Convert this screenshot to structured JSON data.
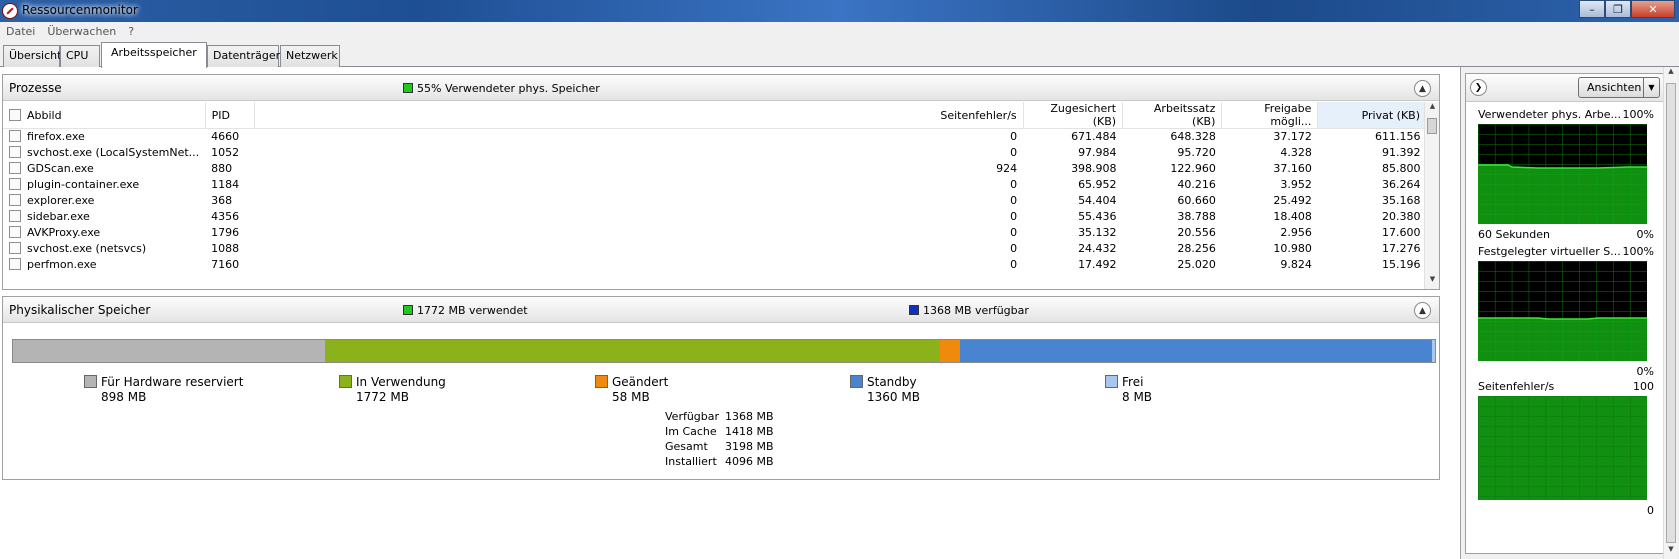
{
  "window": {
    "title": "Ressourcenmonitor"
  },
  "menu": [
    "Datei",
    "Überwachen",
    "?"
  ],
  "tabs": [
    "Übersicht",
    "CPU",
    "Arbeitsspeicher",
    "Datenträger",
    "Netzwerk"
  ],
  "active_tab": "Arbeitsspeicher",
  "processes": {
    "title": "Prozesse",
    "legend_text": "55% Verwendeter phys. Speicher",
    "legend_color": "#1fc81f",
    "columns": [
      "Abbild",
      "PID",
      "Seitenfehler/s",
      "Zugesichert (KB)",
      "Arbeitssatz (KB)",
      "Freigabe mögli...",
      "Privat (KB)"
    ],
    "rows": [
      [
        "firefox.exe",
        "4660",
        "0",
        "671.484",
        "648.328",
        "37.172",
        "611.156"
      ],
      [
        "svchost.exe (LocalSystemNet...",
        "1052",
        "0",
        "97.984",
        "95.720",
        "4.328",
        "91.392"
      ],
      [
        "GDScan.exe",
        "880",
        "924",
        "398.908",
        "122.960",
        "37.160",
        "85.800"
      ],
      [
        "plugin-container.exe",
        "1184",
        "0",
        "65.952",
        "40.216",
        "3.952",
        "36.264"
      ],
      [
        "explorer.exe",
        "368",
        "0",
        "54.404",
        "60.660",
        "25.492",
        "35.168"
      ],
      [
        "sidebar.exe",
        "4356",
        "0",
        "55.436",
        "38.788",
        "18.408",
        "20.380"
      ],
      [
        "AVKProxy.exe",
        "1796",
        "0",
        "35.132",
        "20.556",
        "2.956",
        "17.600"
      ],
      [
        "svchost.exe (netsvcs)",
        "1088",
        "0",
        "24.432",
        "28.256",
        "10.980",
        "17.276"
      ],
      [
        "perfmon.exe",
        "7160",
        "0",
        "17.492",
        "25.020",
        "9.824",
        "15.196"
      ]
    ]
  },
  "physical": {
    "title": "Physikalischer Speicher",
    "used_label": "1772 MB verwendet",
    "used_color": "#1fc81f",
    "avail_label": "1368 MB verfügbar",
    "avail_color": "#1030c0",
    "bar": [
      {
        "name": "Für Hardware reserviert",
        "mb": 898,
        "color": "#b4b4b4"
      },
      {
        "name": "In Verwendung",
        "mb": 1772,
        "color": "#8bb21a"
      },
      {
        "name": "Geändert",
        "mb": 58,
        "color": "#f08a0c"
      },
      {
        "name": "Standby",
        "mb": 1360,
        "color": "#4884d0"
      },
      {
        "name": "Frei",
        "mb": 8,
        "color": "#a8c6ee"
      }
    ],
    "legend": [
      {
        "label": "Für Hardware reserviert",
        "value": "898 MB"
      },
      {
        "label": "In Verwendung",
        "value": "1772 MB"
      },
      {
        "label": "Geändert",
        "value": "58 MB"
      },
      {
        "label": "Standby",
        "value": "1360 MB"
      },
      {
        "label": "Frei",
        "value": "8 MB"
      }
    ],
    "stats": [
      {
        "label": "Verfügbar",
        "value": "1368 MB"
      },
      {
        "label": "Im Cache",
        "value": "1418 MB"
      },
      {
        "label": "Gesamt",
        "value": "3198 MB"
      },
      {
        "label": "Installiert",
        "value": "4096 MB"
      }
    ]
  },
  "sidepanel": {
    "views_button": "Ansichten",
    "graphs": [
      {
        "title": "Verwendeter phys. Arbe...",
        "max": "100%",
        "time_label": "60 Sekunden",
        "min": "0%"
      },
      {
        "title": "Festgelegter virtueller S...",
        "max": "100%",
        "time_label": "",
        "min": "0%"
      },
      {
        "title": "Seitenfehler/s",
        "max": "100",
        "time_label": "",
        "min": "0"
      }
    ]
  }
}
